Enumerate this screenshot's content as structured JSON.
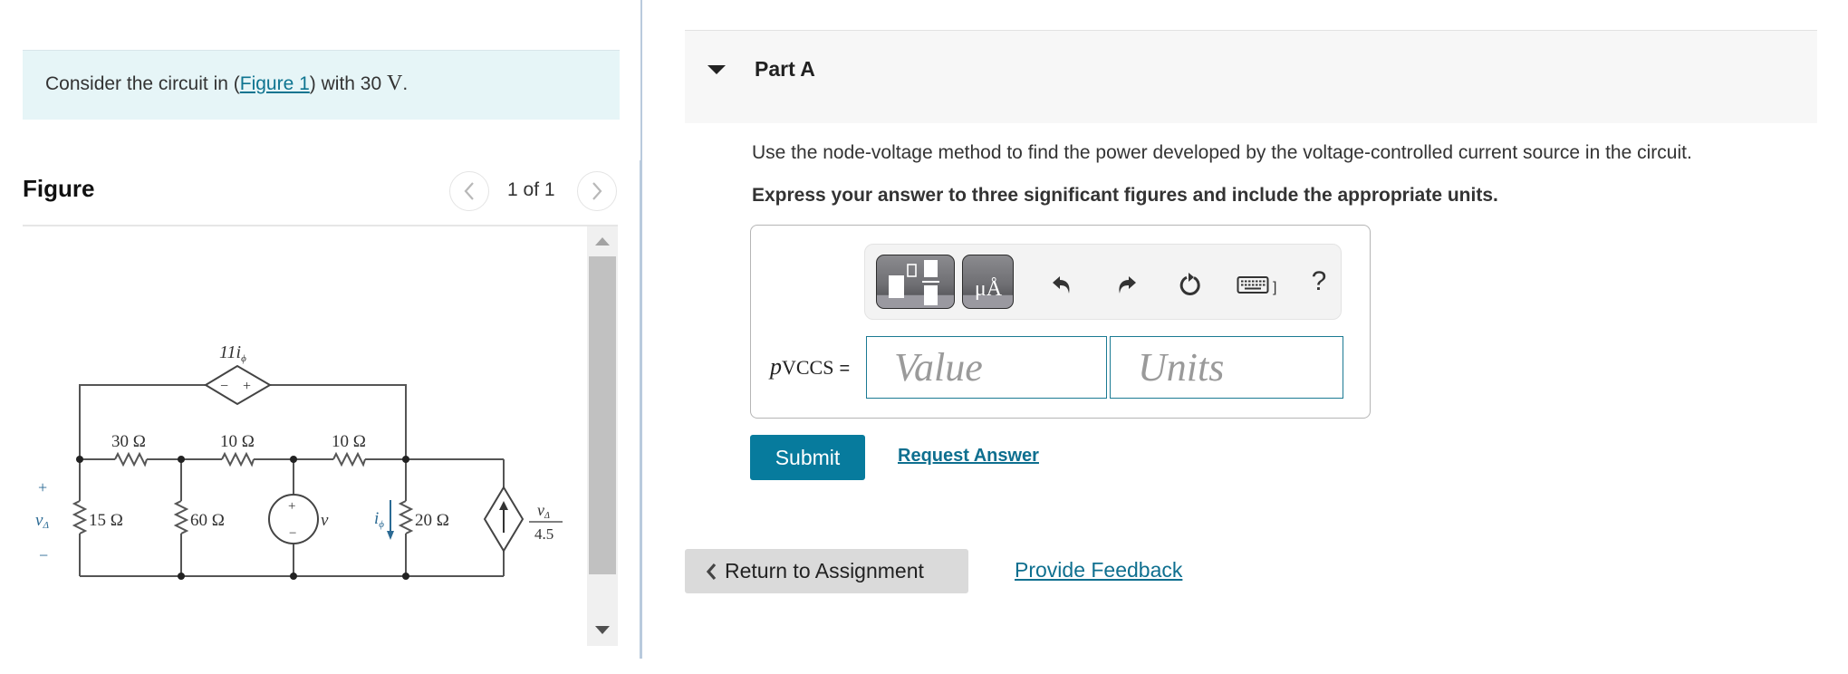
{
  "problem": {
    "intro_prefix": "Consider the circuit in (",
    "figure_link": "Figure 1",
    "intro_suffix": ") with 30 ",
    "voltage_unit": "V",
    "period": "."
  },
  "figure": {
    "title": "Figure",
    "page_indicator": "1 of 1",
    "scroll_position": 0.0,
    "circuit": {
      "dependent_voltage_source_label": "11i",
      "dependent_voltage_source_subscript": "ϕ",
      "resistors": [
        "30 Ω",
        "10 Ω",
        "10 Ω",
        "15 Ω",
        "60 Ω",
        "20 Ω"
      ],
      "independent_source_label": "v",
      "v_delta_label": "v",
      "v_delta_subscript": "Δ",
      "v_delta_plus": "+",
      "v_delta_minus": "−",
      "i_phi_label": "i",
      "i_phi_subscript": "ϕ",
      "dependent_current_numerator": "v",
      "dependent_current_numerator_subscript": "Δ",
      "dependent_current_denominator": "4.5",
      "polarity_plus": "+",
      "polarity_minus": "−"
    }
  },
  "part": {
    "title": "Part A",
    "question": "Use the node-voltage method to find the power developed by the voltage-controlled current source in the circuit.",
    "instruction": "Express your answer to three significant figures and include the appropriate units.",
    "toolbar": {
      "templates_icon": "fraction-template-icon",
      "units_label": "μÅ",
      "undo_icon": "undo-icon",
      "redo_icon": "redo-icon",
      "reset_icon": "reset-icon",
      "keyboard_icon": "keyboard-icon",
      "keyboard_suffix": "]",
      "help_label": "?"
    },
    "variable_symbol": "p",
    "variable_subscript": "VCCS",
    "equals": "=",
    "value_placeholder": "Value",
    "units_placeholder": "Units",
    "value": "",
    "units": "",
    "submit_label": "Submit",
    "request_answer_label": "Request Answer"
  },
  "footer": {
    "return_label": "Return to Assignment",
    "feedback_label": "Provide Feedback"
  },
  "colors": {
    "accent": "#077b9d",
    "link": "#0e6f8f",
    "info_bg": "#e6f5f7",
    "circuit_annotation": "#2b6a94"
  }
}
